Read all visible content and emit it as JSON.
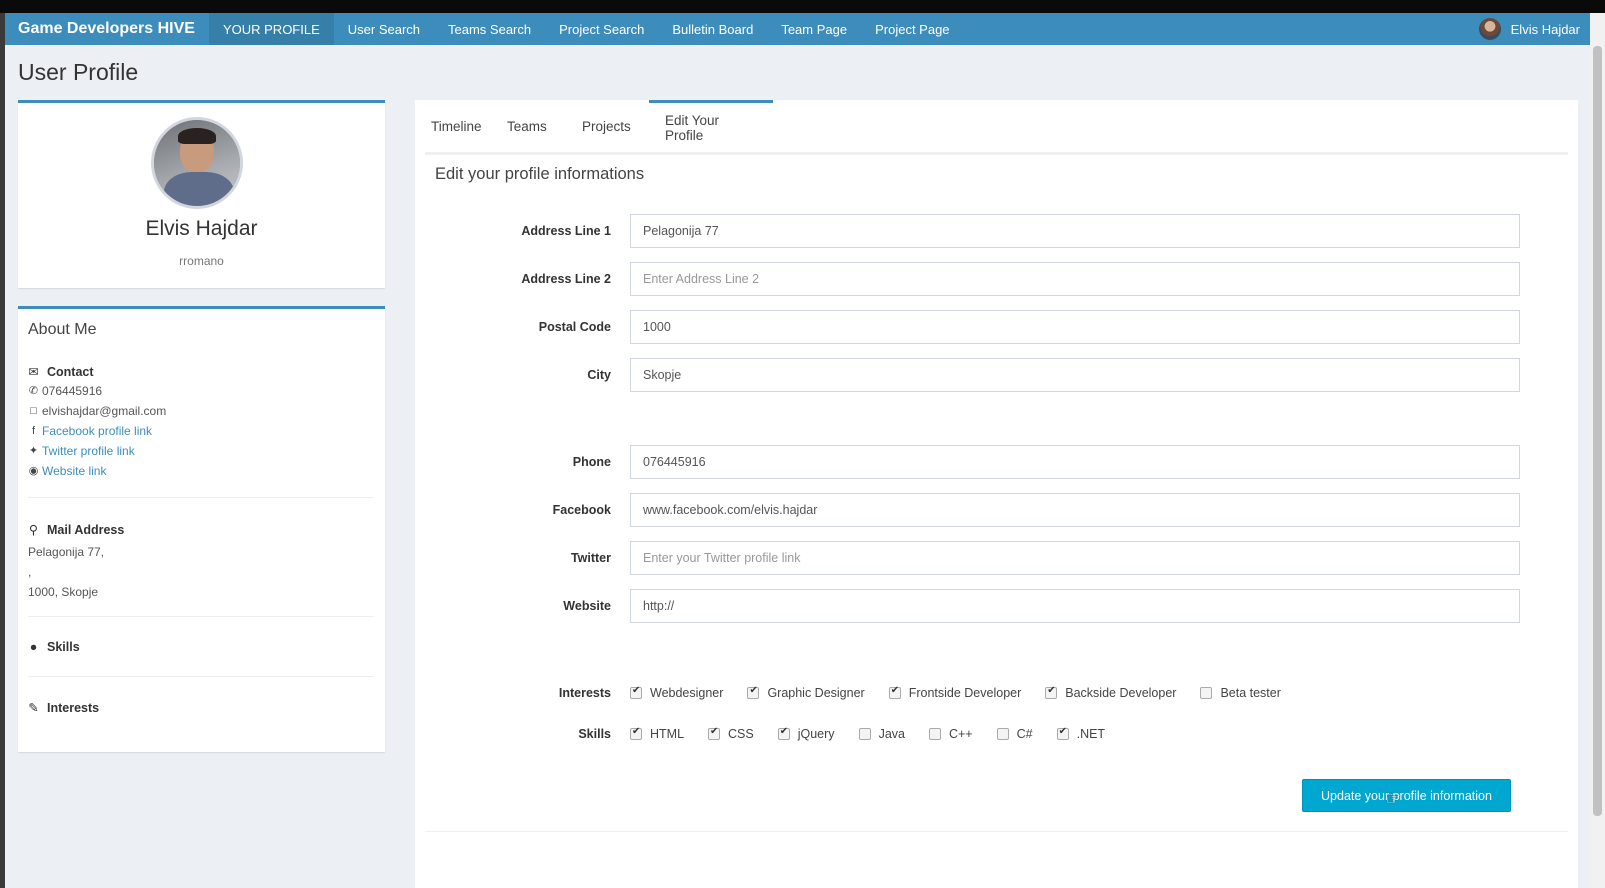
{
  "navbar": {
    "brand": "Game Developers HIVE",
    "items": [
      {
        "label": "YOUR PROFILE",
        "active": true
      },
      {
        "label": "User Search"
      },
      {
        "label": "Teams Search"
      },
      {
        "label": "Project Search"
      },
      {
        "label": "Bulletin Board"
      },
      {
        "label": "Team Page"
      },
      {
        "label": "Project Page"
      }
    ],
    "user_name": "Elvis Hajdar"
  },
  "page": {
    "title": "User Profile"
  },
  "profile": {
    "name": "Elvis Hajdar",
    "username": "rromano"
  },
  "about": {
    "title": "About Me",
    "contact": {
      "heading": "Contact",
      "phone": "076445916",
      "email": "elvishajdar@gmail.com",
      "facebook": "Facebook profile link",
      "twitter": "Twitter profile link",
      "website": "Website link"
    },
    "mail": {
      "heading": "Mail Address",
      "line1": "Pelagonija 77,",
      "line2": ",",
      "line3": "1000, Skopje"
    },
    "skills_heading": "Skills",
    "interests_heading": "Interests"
  },
  "tabs": [
    "Timeline",
    "Teams",
    "Projects",
    "Edit Your Profile"
  ],
  "form": {
    "title": "Edit your profile informations",
    "fields": {
      "address1": {
        "label": "Address Line 1",
        "value": "Pelagonija 77",
        "placeholder": ""
      },
      "address2": {
        "label": "Address Line 2",
        "value": "",
        "placeholder": "Enter Address Line 2"
      },
      "postal": {
        "label": "Postal Code",
        "value": "1000",
        "placeholder": ""
      },
      "city": {
        "label": "City",
        "value": "Skopje",
        "placeholder": ""
      },
      "phone": {
        "label": "Phone",
        "value": "076445916",
        "placeholder": ""
      },
      "facebook": {
        "label": "Facebook",
        "value": "www.facebook.com/elvis.hajdar",
        "placeholder": ""
      },
      "twitter": {
        "label": "Twitter",
        "value": "",
        "placeholder": "Enter your Twitter profile link"
      },
      "website": {
        "label": "Website",
        "value": "http://",
        "placeholder": ""
      }
    },
    "interests": {
      "label": "Interests",
      "options": [
        {
          "label": "Webdesigner",
          "checked": true
        },
        {
          "label": "Graphic Designer",
          "checked": true
        },
        {
          "label": "Frontside Developer",
          "checked": true
        },
        {
          "label": "Backside Developer",
          "checked": true
        },
        {
          "label": "Beta tester",
          "checked": false
        }
      ]
    },
    "skills": {
      "label": "Skills",
      "options": [
        {
          "label": "HTML",
          "checked": true
        },
        {
          "label": "CSS",
          "checked": true
        },
        {
          "label": "jQuery",
          "checked": true
        },
        {
          "label": "Java",
          "checked": false
        },
        {
          "label": "C++",
          "checked": false
        },
        {
          "label": "C#",
          "checked": false
        },
        {
          "label": ".NET",
          "checked": true
        }
      ]
    },
    "submit_label": "Update your profile information"
  },
  "colors": {
    "primary": "#3c8dbc",
    "button": "#00a7d0",
    "background": "#ecf0f5"
  }
}
